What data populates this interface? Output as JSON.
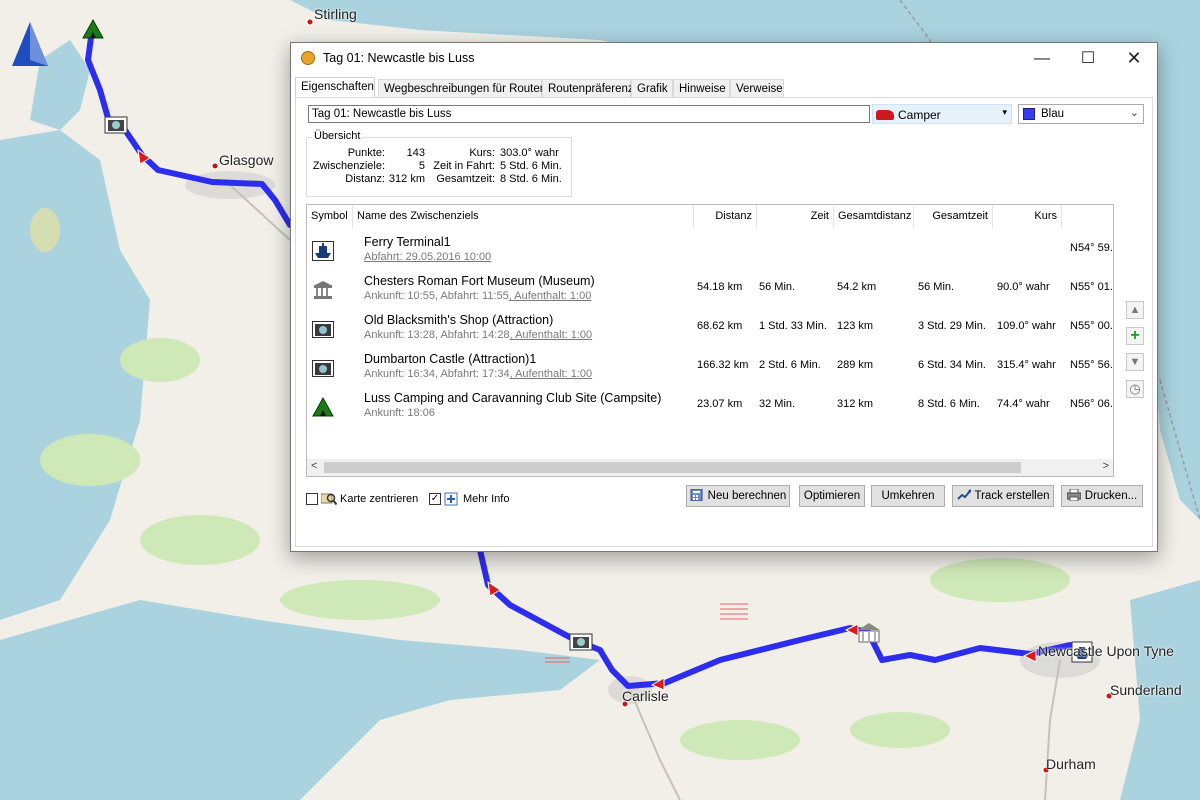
{
  "map": {
    "cities": [
      {
        "name": "Stirling"
      },
      {
        "name": "Glasgow"
      },
      {
        "name": "Carlisle"
      },
      {
        "name": "Newcastle Upon Tyne"
      },
      {
        "name": "Sunderland"
      },
      {
        "name": "Durham"
      }
    ],
    "route_color": "#2d2df0",
    "water_color": "#aad3df",
    "land_color": "#f2efe9",
    "park_color": "#cfe8b7"
  },
  "dialog": {
    "title": "Tag 01: Newcastle bis Luss",
    "controls": {
      "minimize": "—",
      "maximize": "☐",
      "close": "✕"
    },
    "tabs": [
      {
        "label": "Eigenschaften",
        "active": true
      },
      {
        "label": "Wegbeschreibungen für Routen"
      },
      {
        "label": "Routenpräferenz"
      },
      {
        "label": "Grafik"
      },
      {
        "label": "Hinweise"
      },
      {
        "label": "Verweise"
      }
    ],
    "name_value": "Tag 01: Newcastle bis Luss",
    "vehicle": {
      "label": "Camper",
      "icon": "car-icon",
      "arrow": "▾"
    },
    "color": {
      "label": "Blau",
      "swatch": "#3a3af0",
      "arrow": "⌄"
    },
    "overview": {
      "legend": "Übersicht",
      "punkte_label": "Punkte:",
      "punkte_value": "143",
      "zwischenziele_label": "Zwischenziele:",
      "zwischenziele_value": "5",
      "distanz_label": "Distanz:",
      "distanz_value": "312 km",
      "kurs_label": "Kurs:",
      "kurs_value": "303.0° wahr",
      "zeit_fahrt_label": "Zeit in Fahrt:",
      "zeit_fahrt_value": "5 Std. 6 Min.",
      "gesamtzeit_label": "Gesamtzeit:",
      "gesamtzeit_value": "8 Std. 6 Min."
    },
    "table": {
      "headers": {
        "symbol": "Symbol",
        "name": "Name des Zwischenziels",
        "distanz": "Distanz",
        "zeit": "Zeit",
        "gesamtdistanz": "Gesamtdistanz",
        "gesamtzeit": "Gesamtzeit",
        "kurs": "Kurs"
      },
      "rows": [
        {
          "icon": "ferry-icon",
          "name": "Ferry Terminal1",
          "sub1": "Abfahrt: 29.05.2016 10:00",
          "sub2": "",
          "sub3": "",
          "distanz": "",
          "zeit": "",
          "gesamtdistanz": "",
          "gesamtzeit": "",
          "kurs": "",
          "pos": "N54° 59."
        },
        {
          "icon": "museum-icon",
          "name": "Chesters Roman Fort Museum (Museum)",
          "sub1": "Ankunft: 10:55",
          "sub2": ",  Abfahrt: 11:55",
          "sub3": ",  Aufenthalt: 1:00",
          "distanz": "54.18 km",
          "zeit": "56 Min.",
          "gesamtdistanz": "54.2 km",
          "gesamtzeit": "56 Min.",
          "kurs": "90.0° wahr",
          "pos": "N55° 01."
        },
        {
          "icon": "camera-icon",
          "name": "Old Blacksmith's Shop (Attraction)",
          "sub1": "Ankunft: 13:28",
          "sub2": ",  Abfahrt: 14:28",
          "sub3": ",  Aufenthalt: 1:00",
          "distanz": "68.62 km",
          "zeit": "1 Std. 33 Min.",
          "gesamtdistanz": "123 km",
          "gesamtzeit": "3 Std. 29 Min.",
          "kurs": "109.0° wahr",
          "pos": "N55° 00."
        },
        {
          "icon": "camera-icon",
          "name": "Dumbarton Castle (Attraction)1",
          "sub1": "Ankunft: 16:34",
          "sub2": ",  Abfahrt: 17:34",
          "sub3": ",  Aufenthalt: 1:00",
          "distanz": "166.32 km",
          "zeit": "2 Std. 6 Min.",
          "gesamtdistanz": "289 km",
          "gesamtzeit": "6 Std. 34 Min.",
          "kurs": "315.4° wahr",
          "pos": "N55° 56."
        },
        {
          "icon": "campsite-icon",
          "name": "Luss Camping and Caravanning Club Site (Campsite)",
          "sub1": "Ankunft: 18:06",
          "sub2": "",
          "sub3": "",
          "distanz": "23.07 km",
          "zeit": "32 Min.",
          "gesamtdistanz": "312 km",
          "gesamtzeit": "8 Std. 6 Min.",
          "kurs": "74.4° wahr",
          "pos": "N56° 06."
        }
      ]
    },
    "scroll": {
      "left": "<",
      "right": ">"
    },
    "side_buttons": {
      "up": "▲",
      "add": "+",
      "down": "▼",
      "clock": "◷"
    },
    "checkboxes": {
      "karte_label": "Karte zentrieren",
      "karte_checked": false,
      "mehr_label": "Mehr Info",
      "mehr_checked": true,
      "check_mark": "✓"
    },
    "buttons": {
      "neu": "Neu berechnen",
      "optimieren": "Optimieren",
      "umkehren": "Umkehren",
      "track": "Track erstellen",
      "drucken": "Drucken..."
    }
  }
}
